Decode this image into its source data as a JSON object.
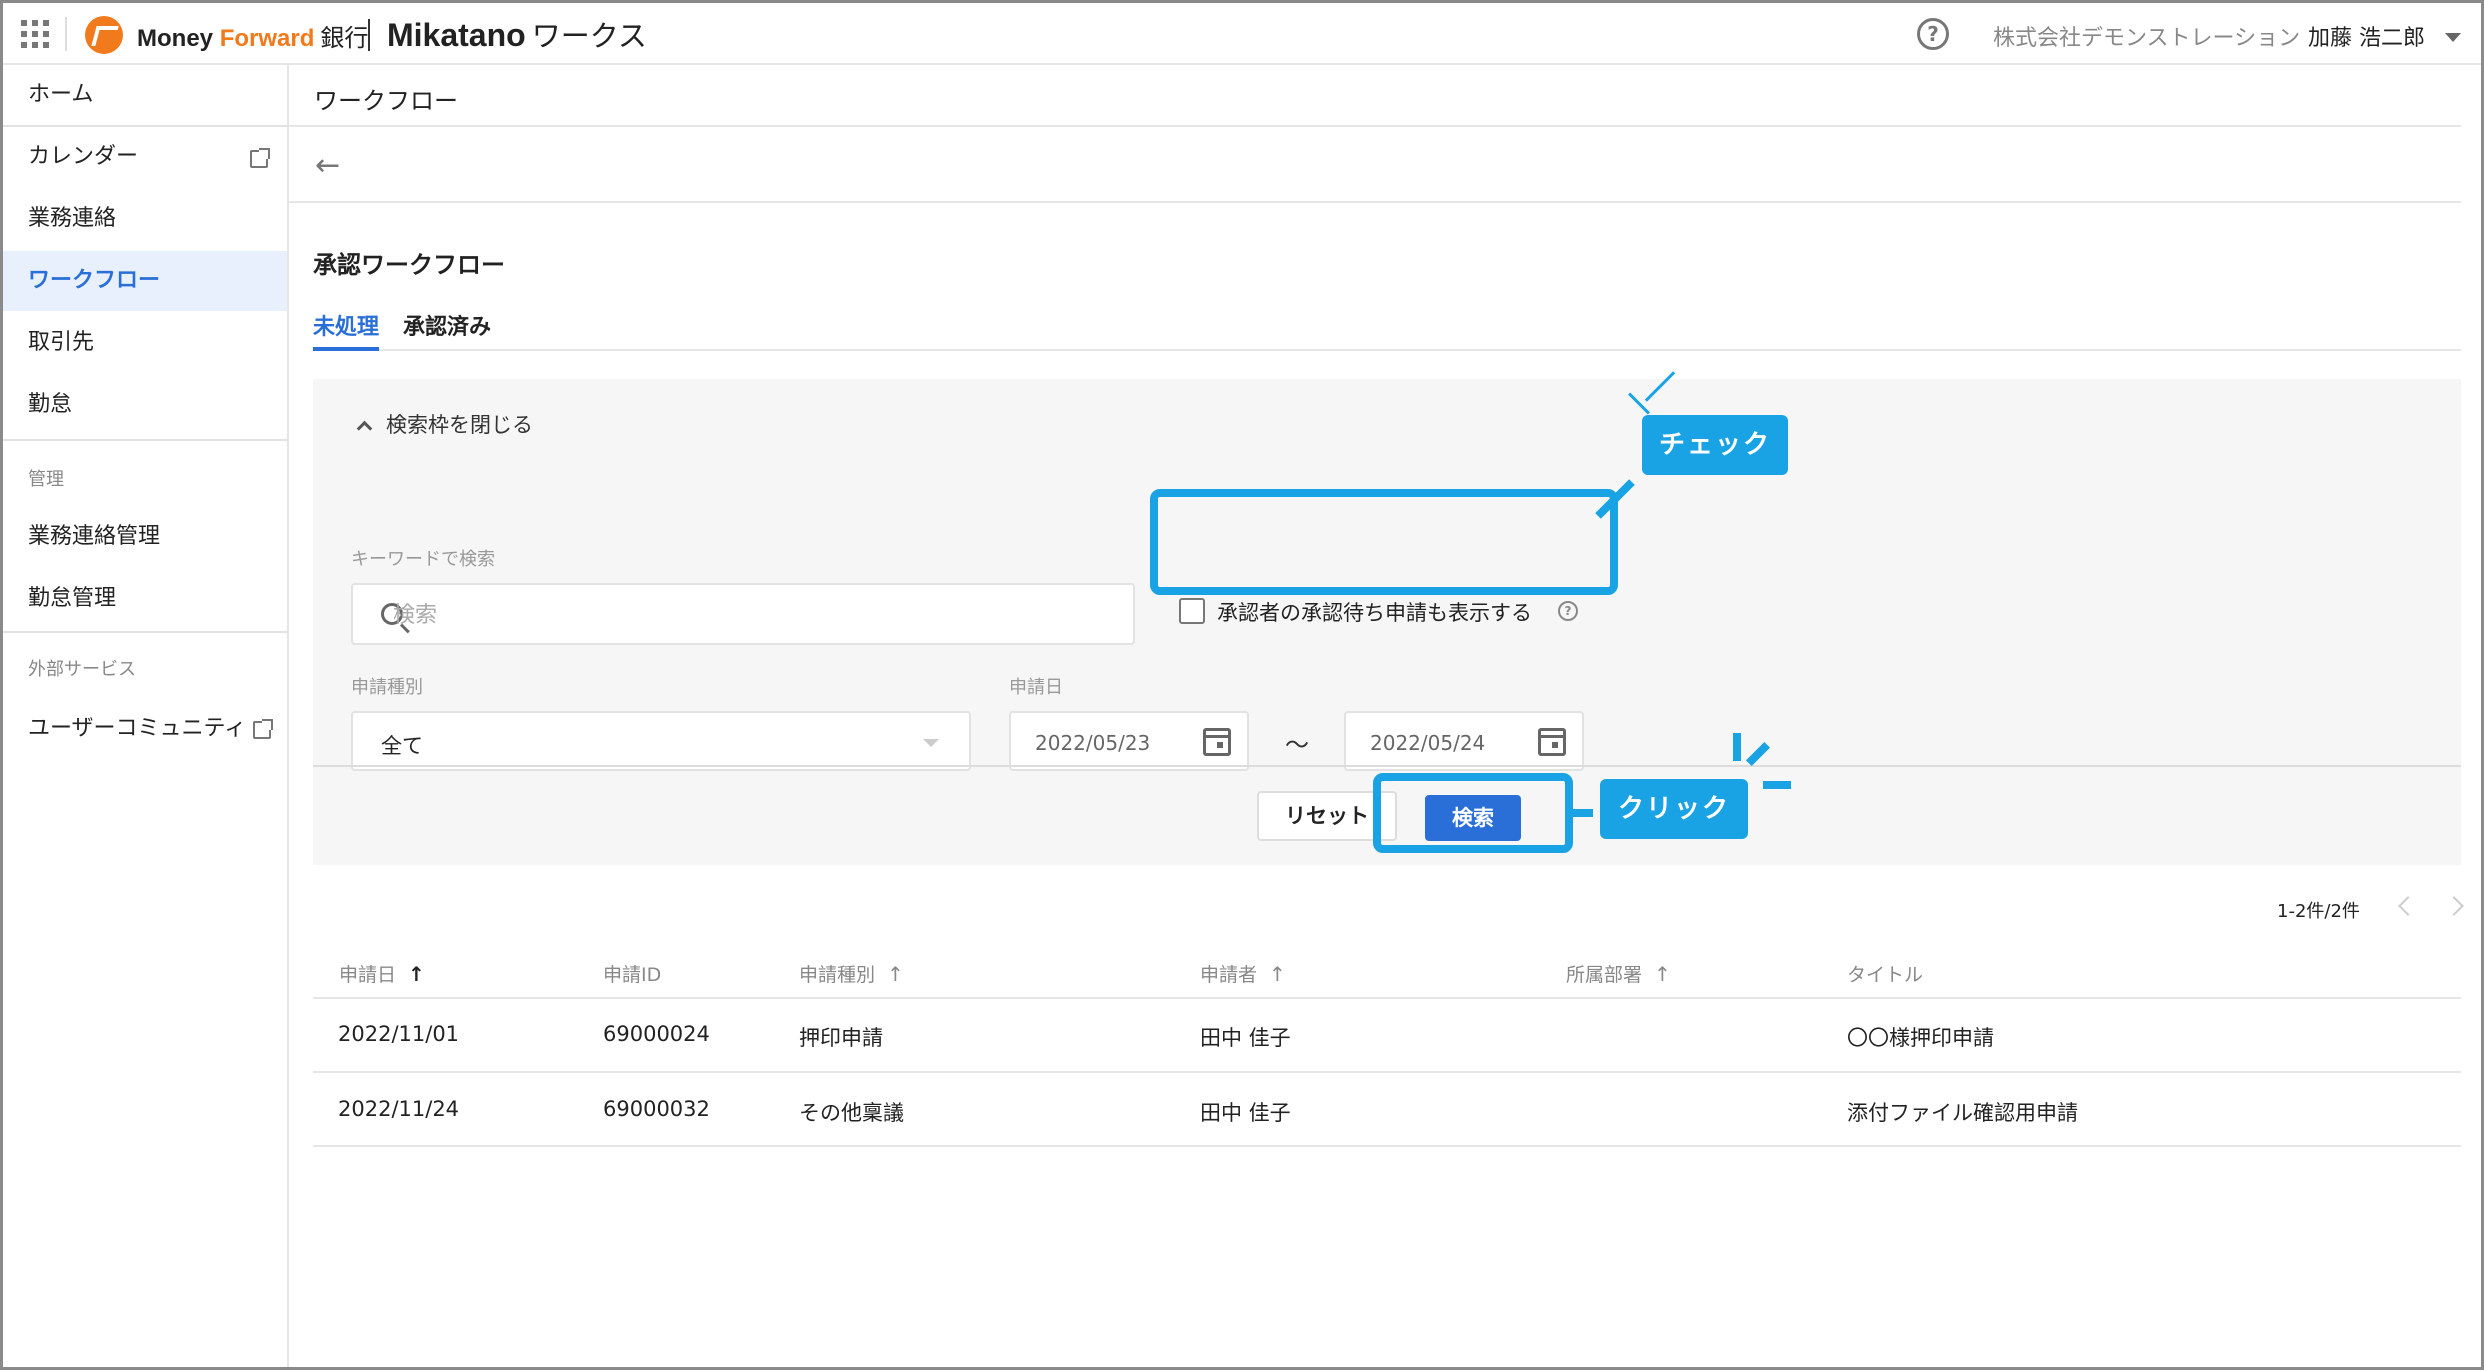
{
  "header": {
    "brand_money": "Money ",
    "brand_forward": "Forward",
    "brand_bank": "銀行",
    "product_name": "Mikatano",
    "product_suffix": "ワークス",
    "company": "株式会社デモンストレーション",
    "user": "加藤 浩二郎"
  },
  "sidebar": {
    "items": [
      {
        "label": "ホーム"
      },
      {
        "label": "カレンダー"
      },
      {
        "label": "業務連絡"
      },
      {
        "label": "ワークフロー"
      },
      {
        "label": "取引先"
      },
      {
        "label": "勤怠"
      }
    ],
    "admin_section": "管理",
    "admin_items": [
      {
        "label": "業務連絡管理"
      },
      {
        "label": "勤怠管理"
      }
    ],
    "external_section": "外部サービス",
    "external_items": [
      {
        "label": "ユーザーコミュニティ"
      }
    ]
  },
  "page": {
    "header_title": "ワークフロー",
    "section_title": "承認ワークフロー",
    "tabs": [
      {
        "label": "未処理"
      },
      {
        "label": "承認済み"
      }
    ]
  },
  "search": {
    "collapse_label": "検索枠を閉じる",
    "keyword_label": "キーワードで検索",
    "keyword_placeholder": "検索",
    "checkbox_label": "承認者の承認待ち申請も表示する",
    "type_label": "申請種別",
    "type_value": "全て",
    "date_label": "申請日",
    "date_from": "2022/05/23",
    "date_to": "2022/05/24",
    "tilde": "〜",
    "reset_label": "リセット",
    "search_label": "検索"
  },
  "annotations": {
    "check_label": "チェック",
    "click_label": "クリック",
    "color": "#1aa3e4"
  },
  "table": {
    "pagination": "1-2件/2件",
    "columns": [
      {
        "label": "申請日"
      },
      {
        "label": "申請ID"
      },
      {
        "label": "申請種別"
      },
      {
        "label": "申請者"
      },
      {
        "label": "所属部署"
      },
      {
        "label": "タイトル"
      }
    ],
    "rows": [
      {
        "date": "2022/11/01",
        "id": "69000024",
        "type": "押印申請",
        "applicant": "田中 佳子",
        "dept": "",
        "title": "〇〇様押印申請"
      },
      {
        "date": "2022/11/24",
        "id": "69000032",
        "type": "その他稟議",
        "applicant": "田中 佳子",
        "dept": "",
        "title": "添付ファイル確認用申請"
      }
    ]
  },
  "colors": {
    "accent": "#2a6fd8",
    "brand_orange": "#f07a1c",
    "active_nav_bg": "#e8f0fd"
  }
}
